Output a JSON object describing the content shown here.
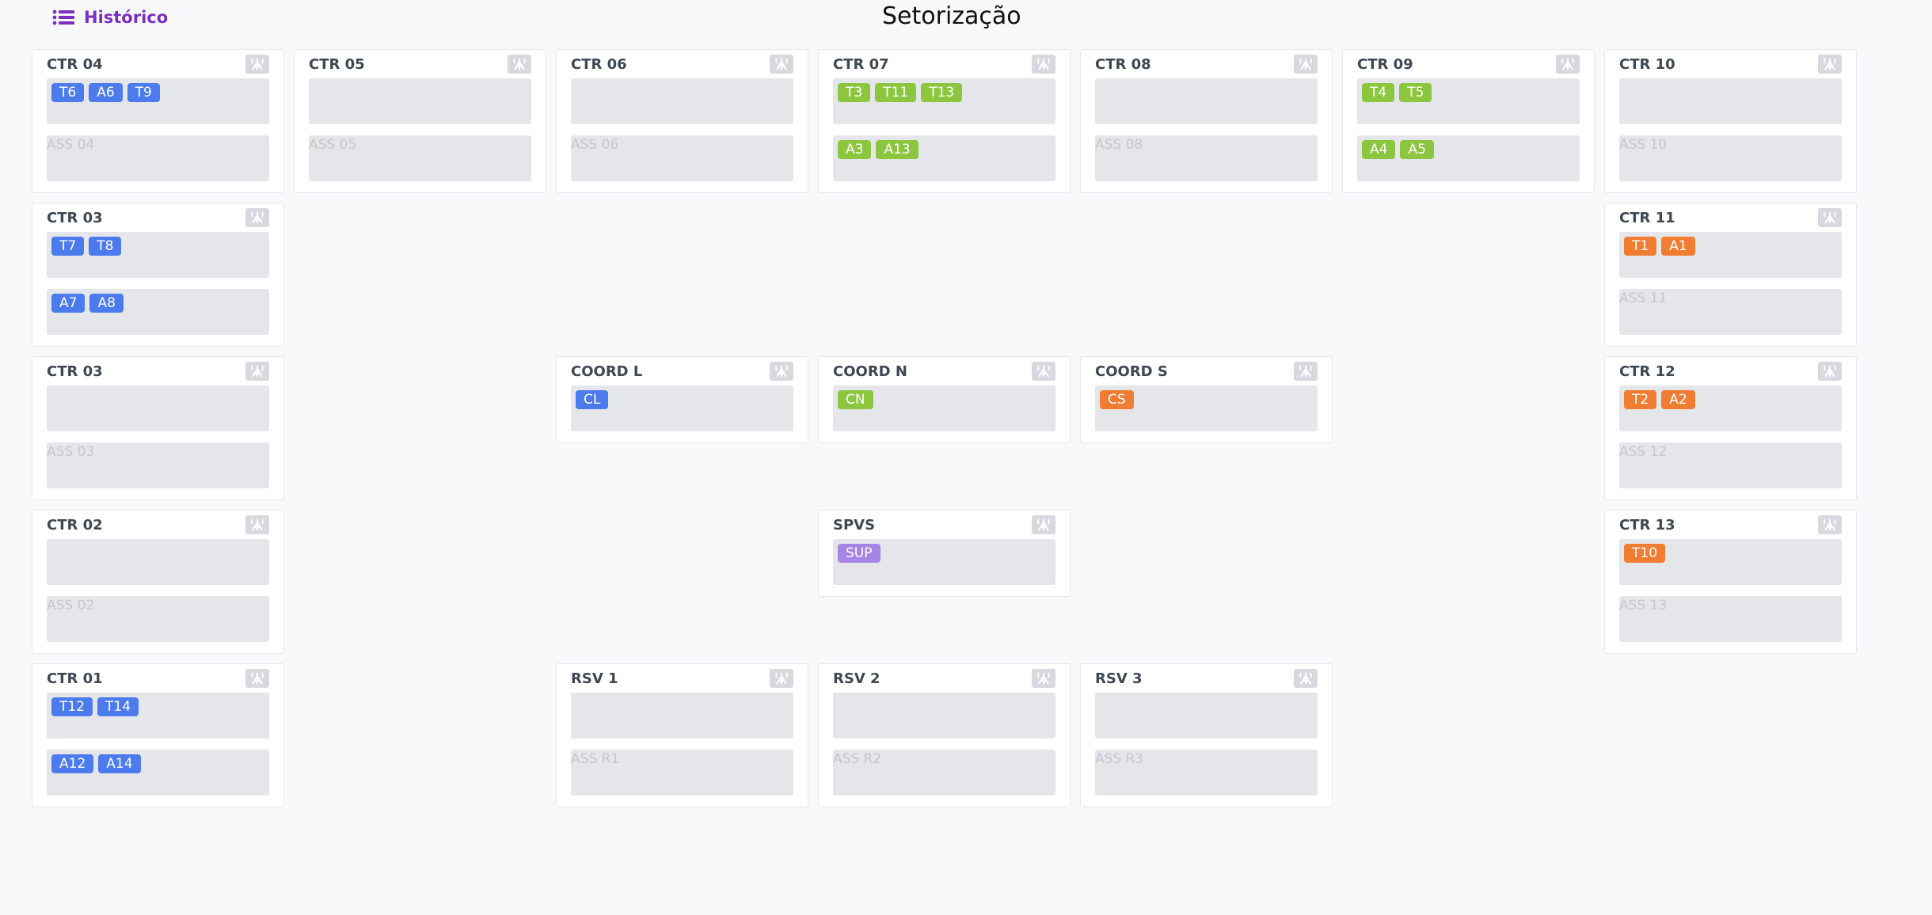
{
  "header": {
    "historico_label": "Histórico",
    "page_title": "Setorização"
  },
  "colors": {
    "blue": "#4b7bec",
    "green": "#8cc63f",
    "orange": "#f07d32",
    "purple": "#a785e6"
  },
  "icons": {
    "position": "antenna-icon",
    "history": "list-icon"
  },
  "cards": [
    {
      "title": "CTR 04",
      "col": 1,
      "row": 1,
      "type": "full",
      "top": [
        [
          "T6",
          "blue"
        ],
        [
          "A6",
          "blue"
        ],
        [
          "T9",
          "blue"
        ]
      ],
      "bottom": [],
      "placeholder": "ASS 04"
    },
    {
      "title": "CTR 05",
      "col": 2,
      "row": 1,
      "type": "full",
      "top": [],
      "bottom": [],
      "placeholder": "ASS 05"
    },
    {
      "title": "CTR 06",
      "col": 3,
      "row": 1,
      "type": "full",
      "top": [],
      "bottom": [],
      "placeholder": "ASS 06"
    },
    {
      "title": "CTR 07",
      "col": 4,
      "row": 1,
      "type": "full",
      "top": [
        [
          "T3",
          "green"
        ],
        [
          "T11",
          "green"
        ],
        [
          "T13",
          "green"
        ]
      ],
      "bottom": [
        [
          "A3",
          "green"
        ],
        [
          "A13",
          "green"
        ]
      ],
      "placeholder": ""
    },
    {
      "title": "CTR 08",
      "col": 5,
      "row": 1,
      "type": "full",
      "top": [],
      "bottom": [],
      "placeholder": "ASS 08"
    },
    {
      "title": "CTR 09",
      "col": 6,
      "row": 1,
      "type": "full",
      "top": [
        [
          "T4",
          "green"
        ],
        [
          "T5",
          "green"
        ]
      ],
      "bottom": [
        [
          "A4",
          "green"
        ],
        [
          "A5",
          "green"
        ]
      ],
      "placeholder": ""
    },
    {
      "title": "CTR 10",
      "col": 7,
      "row": 1,
      "type": "full",
      "top": [],
      "bottom": [],
      "placeholder": "ASS 10"
    },
    {
      "title": "CTR 03",
      "col": 1,
      "row": 2,
      "type": "full",
      "top": [
        [
          "T7",
          "blue"
        ],
        [
          "T8",
          "blue"
        ]
      ],
      "bottom": [
        [
          "A7",
          "blue"
        ],
        [
          "A8",
          "blue"
        ]
      ],
      "placeholder": ""
    },
    {
      "title": "CTR 11",
      "col": 7,
      "row": 2,
      "type": "full",
      "top": [
        [
          "T1",
          "orange"
        ],
        [
          "A1",
          "orange"
        ]
      ],
      "bottom": [],
      "placeholder": "ASS 11"
    },
    {
      "title": "CTR 03",
      "col": 1,
      "row": 3,
      "type": "full",
      "top": [],
      "bottom": [],
      "placeholder": "ASS 03"
    },
    {
      "title": "COORD L",
      "col": 3,
      "row": 3,
      "type": "short",
      "top": [
        [
          "CL",
          "blue"
        ]
      ]
    },
    {
      "title": "COORD N",
      "col": 4,
      "row": 3,
      "type": "short",
      "top": [
        [
          "CN",
          "green"
        ]
      ]
    },
    {
      "title": "COORD S",
      "col": 5,
      "row": 3,
      "type": "short",
      "top": [
        [
          "CS",
          "orange"
        ]
      ]
    },
    {
      "title": "CTR 12",
      "col": 7,
      "row": 3,
      "type": "full",
      "top": [
        [
          "T2",
          "orange"
        ],
        [
          "A2",
          "orange"
        ]
      ],
      "bottom": [],
      "placeholder": "ASS 12"
    },
    {
      "title": "CTR 02",
      "col": 1,
      "row": 4,
      "type": "full",
      "top": [],
      "bottom": [],
      "placeholder": "ASS 02"
    },
    {
      "title": "SPVS",
      "col": 4,
      "row": 4,
      "type": "short",
      "top": [
        [
          "SUP",
          "purple"
        ]
      ]
    },
    {
      "title": "CTR 13",
      "col": 7,
      "row": 4,
      "type": "full",
      "top": [
        [
          "T10",
          "orange"
        ]
      ],
      "bottom": [],
      "placeholder": "ASS 13"
    },
    {
      "title": "CTR 01",
      "col": 1,
      "row": 5,
      "type": "full",
      "top": [
        [
          "T12",
          "blue"
        ],
        [
          "T14",
          "blue"
        ]
      ],
      "bottom": [
        [
          "A12",
          "blue"
        ],
        [
          "A14",
          "blue"
        ]
      ],
      "placeholder": ""
    },
    {
      "title": "RSV 1",
      "col": 3,
      "row": 5,
      "type": "full",
      "top": [],
      "bottom": [],
      "placeholder": "ASS R1"
    },
    {
      "title": "RSV 2",
      "col": 4,
      "row": 5,
      "type": "full",
      "top": [],
      "bottom": [],
      "placeholder": "ASS R2"
    },
    {
      "title": "RSV 3",
      "col": 5,
      "row": 5,
      "type": "full",
      "top": [],
      "bottom": [],
      "placeholder": "ASS R3"
    }
  ]
}
